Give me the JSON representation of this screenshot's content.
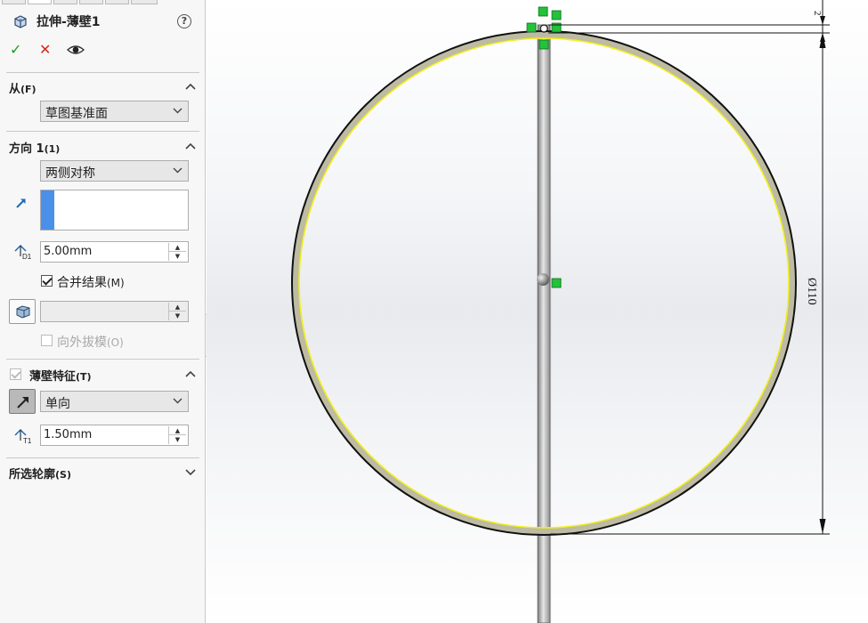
{
  "feature": {
    "title": "拉伸-薄壁1",
    "help_symbol": "?",
    "ok_symbol": "✓",
    "cancel_symbol": "✕"
  },
  "from_section": {
    "title": "从",
    "shortcut": "(F)",
    "start_condition": "草图基准面"
  },
  "direction1": {
    "title": "方向 1",
    "shortcut": "(1)",
    "end_condition": "两侧对称",
    "depth_value": "5.00mm",
    "merge_result_label": "合并结果",
    "merge_result_shortcut": "(M)",
    "merge_result_checked": true,
    "draft_label": "向外拔模",
    "draft_shortcut": "(O)",
    "draft_checked": false,
    "draft_value": ""
  },
  "thin_feature": {
    "title": "薄壁特征",
    "shortcut": "(T)",
    "enabled": true,
    "type": "单向",
    "thickness_value": "1.50mm"
  },
  "selected_contours": {
    "title": "所选轮廓",
    "shortcut": "(S)"
  },
  "dimensions": {
    "diameter_label": "Ø110",
    "thickness_label": "2"
  },
  "colors": {
    "checkmark": "#1a9a28",
    "cancel": "#d8261a",
    "selection_blue": "#4a90e8",
    "preview_yellow": "#f2ef1c",
    "constraint_green": "#22c23a"
  }
}
